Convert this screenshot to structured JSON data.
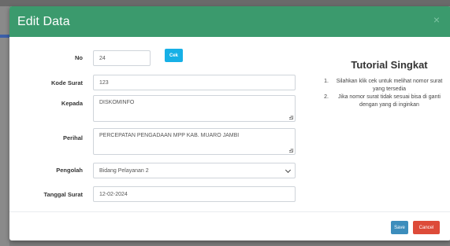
{
  "modal": {
    "title": "Edit Data",
    "close_glyph": "×"
  },
  "form": {
    "no": {
      "label": "No",
      "value": "24"
    },
    "cek_button": "Cek",
    "kode_surat": {
      "label": "Kode Surat",
      "value": "123"
    },
    "kepada": {
      "label": "Kepada",
      "value": "DISKOMINFO"
    },
    "perihal": {
      "label": "Perihal",
      "value": "PERCEPATAN PENGADAAN MPP KAB. MUARO JAMBI"
    },
    "pengolah": {
      "label": "Pengolah",
      "value": "Bidang Pelayanan 2"
    },
    "tanggal_surat": {
      "label": "Tanggal Surat",
      "value": "12-02-2024"
    }
  },
  "tutorial": {
    "title": "Tutorial Singkat",
    "items": [
      {
        "num": "1.",
        "text": "Silahkan klik cek untuk melihat nomor surat yang tersedia"
      },
      {
        "num": "2.",
        "text": "Jika nomor surat tidak sesuai bisa di ganti dengan yang di inginkan"
      }
    ]
  },
  "footer": {
    "save_label": "Save",
    "cancel_label": "Cancel"
  },
  "colors": {
    "header": "#3b9a6d",
    "cek_button": "#17b0e6",
    "save_button": "#3c8dbc",
    "cancel_button": "#dd4b39"
  }
}
